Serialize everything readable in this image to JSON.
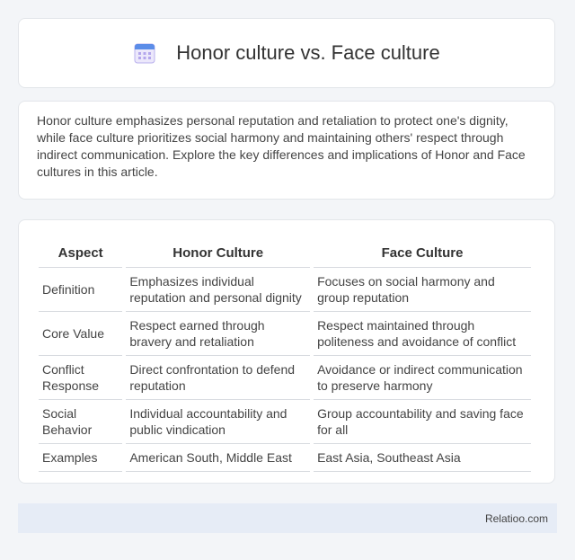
{
  "header": {
    "title": "Honor culture vs. Face culture",
    "icon": "calendar-icon"
  },
  "intro": {
    "text": "Honor culture emphasizes personal reputation and retaliation to protect one's dignity, while face culture prioritizes social harmony and maintaining others' respect through indirect communication. Explore the key differences and implications of Honor and Face cultures in this article."
  },
  "table": {
    "headers": [
      "Aspect",
      "Honor Culture",
      "Face Culture"
    ],
    "rows": [
      [
        "Definition",
        "Emphasizes individual reputation and personal dignity",
        "Focuses on social harmony and group reputation"
      ],
      [
        "Core Value",
        "Respect earned through bravery and retaliation",
        "Respect maintained through politeness and avoidance of conflict"
      ],
      [
        "Conflict Response",
        "Direct confrontation to defend reputation",
        "Avoidance or indirect communication to preserve harmony"
      ],
      [
        "Social Behavior",
        "Individual accountability and public vindication",
        "Group accountability and saving face for all"
      ],
      [
        "Examples",
        "American South, Middle East",
        "East Asia, Southeast Asia"
      ]
    ]
  },
  "footer": {
    "brand": "Relatioo.com"
  }
}
